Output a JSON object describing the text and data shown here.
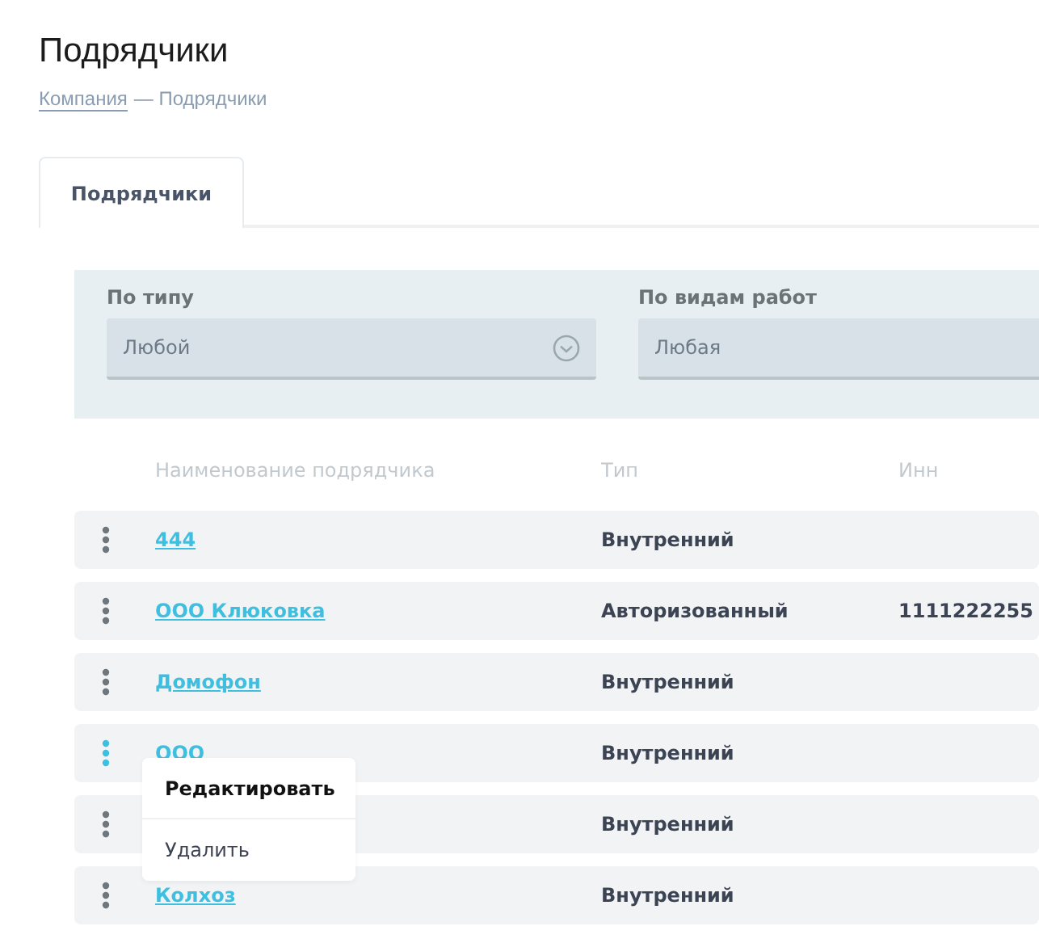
{
  "page": {
    "title": "Подрядчики"
  },
  "breadcrumb": {
    "link": "Компания",
    "current": "— Подрядчики"
  },
  "tabs": [
    {
      "label": "Подрядчики",
      "selected": true
    }
  ],
  "filters": [
    {
      "label": "По типу",
      "value": "Любой"
    },
    {
      "label": "По видам работ",
      "value": "Любая"
    }
  ],
  "table": {
    "columns": [
      "Наименование подрядчика",
      "Тип",
      "Инн"
    ],
    "rows": [
      {
        "name": "444",
        "type": "Внутренний",
        "menu_open": false
      },
      {
        "name": "ООО Клюковка",
        "type": "Авторизованный",
        "inn": "1111222255",
        "menu_open": false
      },
      {
        "name": "Домофон",
        "type": "Внутренний",
        "menu_open": false
      },
      {
        "name": "ООО",
        "type": "Внутренний",
        "menu_open": true
      },
      {
        "type": "Внутренний",
        "menu_open": false
      },
      {
        "name": "Колхоз",
        "type": "Внутренний",
        "menu_open": false
      }
    ]
  },
  "context_menu": {
    "items": [
      {
        "label": "Редактировать",
        "selected": true
      },
      {
        "label": "Удалить",
        "selected": false
      }
    ]
  }
}
